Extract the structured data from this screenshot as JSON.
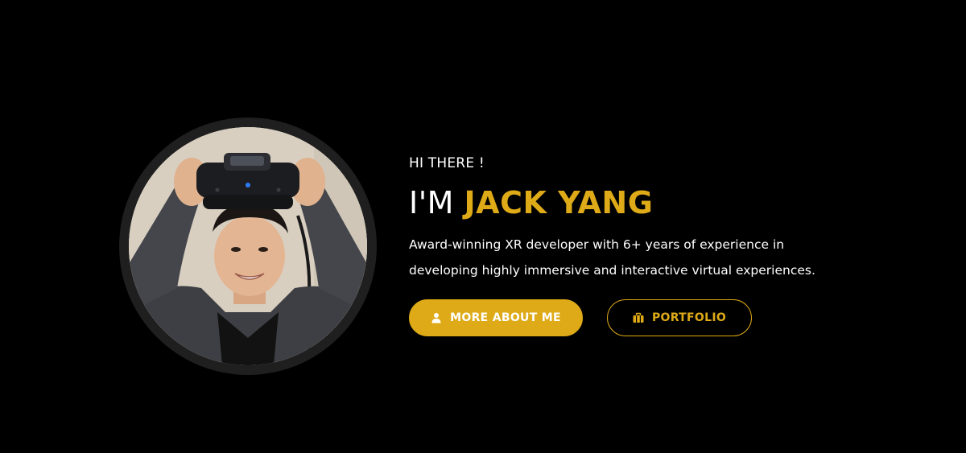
{
  "hero": {
    "greeting": "HI THERE !",
    "headline_prefix": "I'M ",
    "headline_name": "JACK YANG",
    "bio_line1": "Award-winning XR developer with 6+ years of experience in",
    "bio_line2": "developing highly immersive and interactive virtual experiences.",
    "buttons": {
      "about": {
        "label": "MORE ABOUT ME",
        "icon": "user-icon"
      },
      "portfolio": {
        "label": "PORTFOLIO",
        "icon": "briefcase-icon"
      }
    },
    "portrait": {
      "icon": "profile-photo"
    }
  },
  "colors": {
    "background": "#000000",
    "accent": "#deaa17",
    "text": "#ffffff",
    "ring": "#1f1f1f"
  }
}
